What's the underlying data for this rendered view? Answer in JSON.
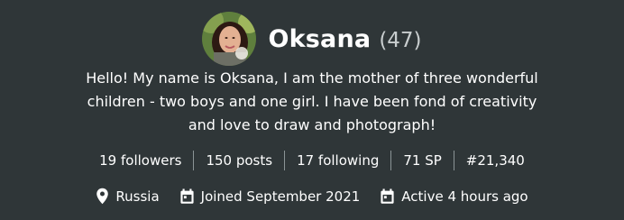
{
  "profile": {
    "name": "Oksana",
    "reputation": "(47)",
    "about": "Hello! My name is Oksana, I am the mother of three wonderful children - two boys and one girl. I have been fond of creativity and love to draw and photograph!"
  },
  "stats": {
    "followers": "19 followers",
    "posts": "150 posts",
    "following": "17 following",
    "sp": "71 SP",
    "rank": "#21,340"
  },
  "meta": {
    "location": "Russia",
    "joined": "Joined September 2021",
    "active": "Active 4 hours ago"
  },
  "icons": {
    "location": "location-pin-icon",
    "joined": "calendar-icon",
    "active": "calendar-icon"
  },
  "colors": {
    "background": "#2f3638",
    "text": "#ffffff",
    "muted": "#c8cdce",
    "divider": "#8b9496"
  }
}
